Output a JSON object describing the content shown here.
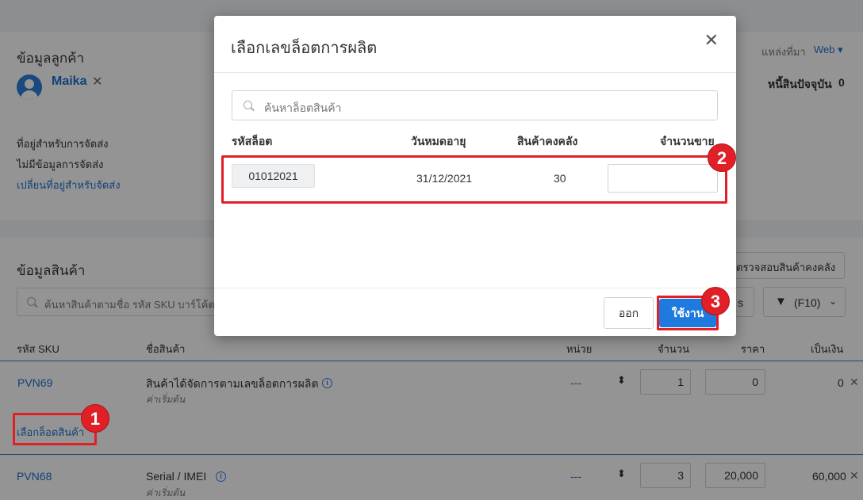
{
  "customer": {
    "section_title": "ข้อมูลลูกค้า",
    "name": "Maika",
    "remove": "✕",
    "source_label": "แหล่งที่มา",
    "source_value": "Web",
    "debt_label": "หนี้สินปัจจุบัน",
    "debt_value": "0",
    "shipping_title": "ที่อยู่สำหรับการจัดส่ง",
    "shipping_none": "ไม่มีข้อมูลการจัดส่ง",
    "change_shipping": "เปลี่ยนที่อยู่สำหรับจัดส่ง"
  },
  "products": {
    "section_title": "ข้อมูลสินค้า",
    "search_placeholder": "ค้นหาสินค้าตามชื่อ รหัส SKU บาร์โค้ด",
    "check_stock_button": "ตรวจสอบสินค้าคงคลัง",
    "scanner_button": "(F10)",
    "partial_button": "s",
    "columns": {
      "sku": "รหัส SKU",
      "name": "ชื่อสินค้า",
      "unit": "หน่วย",
      "qty": "จำนวน",
      "price": "ราคา",
      "total": "เป็นเงิน"
    },
    "rows": [
      {
        "sku": "PVN69",
        "name": "สินค้าได้จัดการตามเลขล็อตการผลิต",
        "sub": "ค่าเริ่มต้น",
        "unit": "---",
        "qty": "1",
        "price": "0",
        "total": "0",
        "action": "เลือกล็อตสินค้า"
      },
      {
        "sku": "PVN68",
        "name": "Serial / IMEI",
        "sub": "ค่าเริ่มต้น",
        "unit": "---",
        "qty": "3",
        "price": "20,000",
        "total": "60,000"
      }
    ]
  },
  "modal": {
    "title": "เลือกเลขล็อตการผลิต",
    "close": "✕",
    "search_placeholder": "ค้นหาล็อตสินค้า",
    "columns": {
      "lot": "รหัสล็อต",
      "expiry": "วันหมดอายุ",
      "stock": "สินค้าคงคลัง",
      "sell_qty": "จำนวนขาย"
    },
    "lot": {
      "code": "01012021",
      "expiry": "31/12/2021",
      "stock": "30",
      "sell_qty": ""
    },
    "exit_button": "ออก",
    "apply_button": "ใช้งาน"
  },
  "callouts": [
    "1",
    "2",
    "3"
  ],
  "colors": {
    "accent": "#1f7ae0",
    "callout": "#e01f26",
    "link": "#1f6fd1"
  }
}
